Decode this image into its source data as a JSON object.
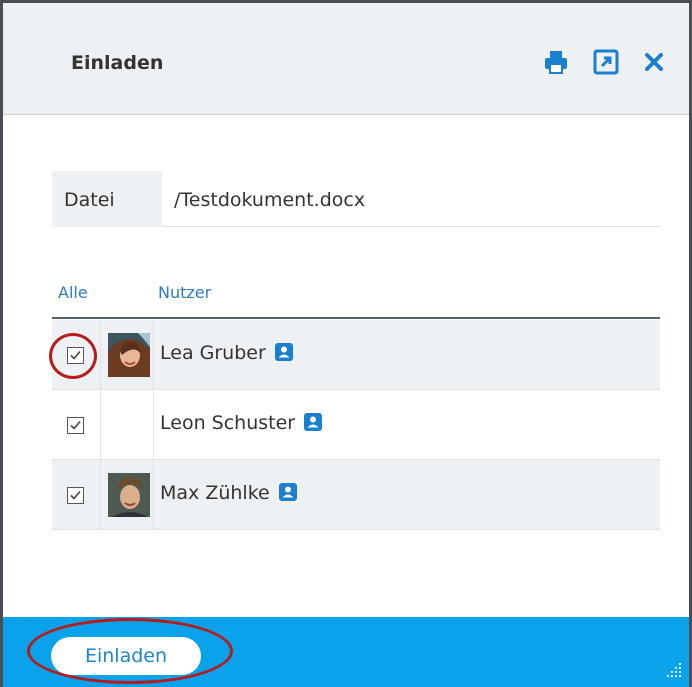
{
  "dialog": {
    "title": "Einladen",
    "icons": [
      "print-icon",
      "popout-icon",
      "close-icon"
    ]
  },
  "file": {
    "label": "Datei",
    "value": "/Testdokument.docx"
  },
  "table": {
    "headers": {
      "all": "Alle",
      "user": "Nutzer"
    },
    "rows": [
      {
        "name": "Lea Gruber",
        "checked": true,
        "has_avatar": true
      },
      {
        "name": "Leon Schuster",
        "checked": true,
        "has_avatar": false
      },
      {
        "name": "Max Zühlke",
        "checked": true,
        "has_avatar": true
      }
    ]
  },
  "footer": {
    "invite_label": "Einladen"
  },
  "colors": {
    "accent": "#0aa2ea",
    "link": "#2b7cc1",
    "icon": "#1b7fd0",
    "annotation": "#b51c1c"
  }
}
